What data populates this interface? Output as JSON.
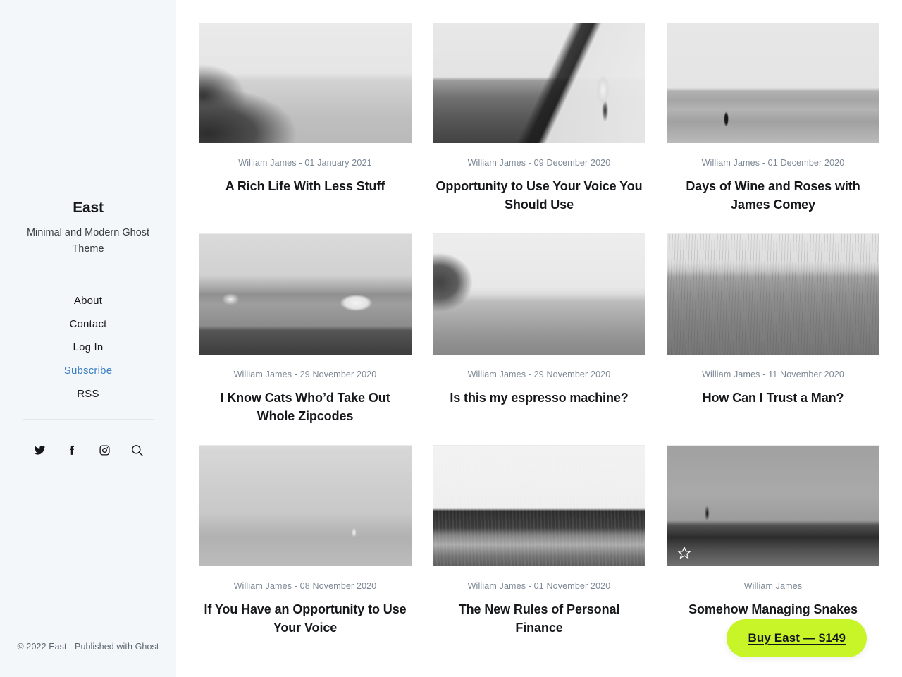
{
  "sidebar": {
    "site_title": "East",
    "site_description": "Minimal and Modern Ghost Theme",
    "nav": [
      {
        "label": "About",
        "accent": false
      },
      {
        "label": "Contact",
        "accent": false
      },
      {
        "label": "Log In",
        "accent": false
      },
      {
        "label": "Subscribe",
        "accent": true
      },
      {
        "label": "RSS",
        "accent": false
      }
    ],
    "social": [
      {
        "name": "twitter-icon",
        "label": "Twitter"
      },
      {
        "name": "facebook-icon",
        "label": "Facebook"
      },
      {
        "name": "instagram-icon",
        "label": "Instagram"
      },
      {
        "name": "search-icon",
        "label": "Search"
      }
    ],
    "copyright": "© 2022 East - Published with Ghost"
  },
  "feed": {
    "posts": [
      {
        "author": "William James",
        "date": "01 January 2021",
        "meta": "William James - 01 January 2021",
        "title": "A Rich Life With Less Stuff",
        "image_name": "hazy-sea-with-rocky-shore",
        "image_class": "ph-sea-rocks",
        "badge": null
      },
      {
        "author": "William James",
        "date": "09 December 2020",
        "meta": "William James - 09 December 2020",
        "title": "Opportunity to Use Your Voice You Should Use",
        "image_name": "person-walking-pebble-beach",
        "image_class": "ph-beach-walker",
        "badge": null
      },
      {
        "author": "William James",
        "date": "01 December 2020",
        "meta": "William James - 01 December 2020",
        "title": "Days of Wine and Roses with James Comey",
        "image_name": "lone-fisherman-on-shore",
        "image_class": "ph-fisherman",
        "badge": null
      },
      {
        "author": "William James",
        "date": "29 November 2020",
        "meta": "William James - 29 November 2020",
        "title": "I Know Cats Who’d Take Out Whole Zipcodes",
        "image_name": "harbour-town-with-ships",
        "image_class": "ph-harbour",
        "badge": null
      },
      {
        "author": "William James",
        "date": "29 November 2020",
        "meta": "William James - 29 November 2020",
        "title": "Is this my espresso machine?",
        "image_name": "cliff-and-wide-beach",
        "image_class": "ph-cliff-beach",
        "badge": null
      },
      {
        "author": "William James",
        "date": "11 November 2020",
        "meta": "William James - 11 November 2020",
        "title": "How Can I Trust a Man?",
        "image_name": "grassy-moor-field",
        "image_class": "ph-grass-field",
        "badge": null
      },
      {
        "author": "William James",
        "date": "08 November 2020",
        "meta": "William James - 08 November 2020",
        "title": "If You Have an Opportunity to Use Your Voice",
        "image_name": "overcast-sea-with-sailboat",
        "image_class": "ph-sea-sail",
        "badge": null
      },
      {
        "author": "William James",
        "date": "01 November 2020",
        "meta": "William James - 01 November 2020",
        "title": "The New Rules of Personal Finance",
        "image_name": "high-contrast-beach",
        "image_class": "ph-beach-contrast",
        "badge": null
      },
      {
        "author": "William James",
        "date": "",
        "meta": "William James",
        "title": "Somehow Managing Snakes",
        "image_name": "pier-with-standing-figure",
        "image_class": "ph-pier-figure",
        "badge": "star-icon"
      }
    ]
  },
  "buy_button": {
    "label": "Buy East — $149",
    "background_color": "#c8f527"
  },
  "colors": {
    "sidebar_background": "#f4f7fa",
    "page_background": "#ffffff",
    "text_primary": "#15171a",
    "text_muted": "#7b8794",
    "accent_link": "#3b7fc4",
    "divider": "#e9ecef",
    "buy_button": "#c8f527"
  }
}
